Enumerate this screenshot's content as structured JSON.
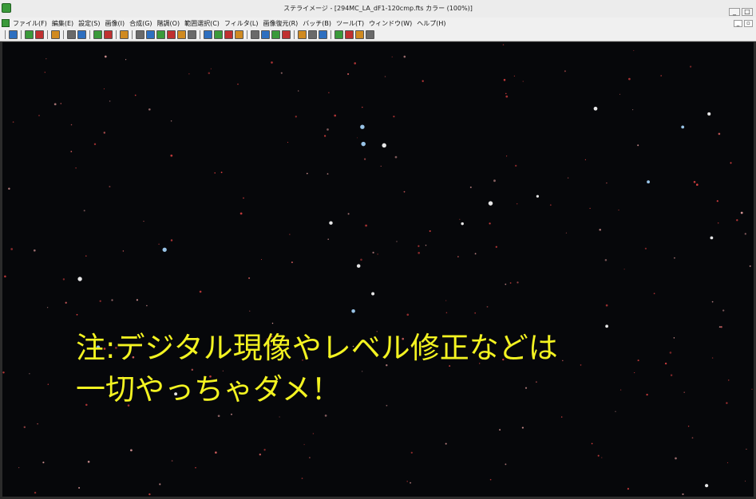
{
  "window": {
    "title": "ステライメージ - [294MC_LA_dF1-120cmp.fts カラー (100%)]",
    "minimize_glyph": "_",
    "restore_glyph": "□"
  },
  "menu": {
    "items": [
      "ファイル(F)",
      "編集(E)",
      "設定(S)",
      "画像(I)",
      "合成(G)",
      "階調(O)",
      "範囲選択(C)",
      "フィルタ(L)",
      "画像復元(R)",
      "バッチ(B)",
      "ツール(T)",
      "ウィンドウ(W)",
      "ヘルプ(H)"
    ],
    "mdi_minimize_glyph": "_",
    "mdi_restore_glyph": "▫"
  },
  "toolbar": {
    "groups": [
      [
        "open-icon"
      ],
      [
        "save-icon",
        "save-as-icon"
      ],
      [
        "export-icon"
      ],
      [
        "print-icon",
        "print-setup-icon"
      ],
      [
        "copy-icon",
        "paste-icon"
      ],
      [
        "info-icon"
      ],
      [
        "level-icon",
        "curve-icon",
        "color-balance-icon",
        "histogram-icon",
        "gamma-icon",
        "frame-icon"
      ],
      [
        "align-icon",
        "grid-icon",
        "stack-icon",
        "star-icon"
      ],
      [
        "bars-icon",
        "chart-icon",
        "monitor-icon",
        "globe-icon"
      ],
      [
        "zoom-icon",
        "rotate-icon",
        "crop-icon"
      ],
      [
        "compare-icon",
        "matrix-icon",
        "measure-icon",
        "target-icon"
      ]
    ],
    "accent_colors": [
      "#2d6fc0",
      "#3a9a3a",
      "#c03030",
      "#d08a20",
      "#6a6a6a"
    ]
  },
  "image": {
    "background": "#06070a",
    "star_colors": [
      "#ff4a4a",
      "#ffb0b0",
      "#ffffff",
      "#a8d8ff",
      "#ff7070"
    ]
  },
  "annotation": {
    "line1": "注:デジタル現像やレベル修正などは",
    "line2": "一切やっちゃダメ！",
    "color": "#f3f321"
  }
}
